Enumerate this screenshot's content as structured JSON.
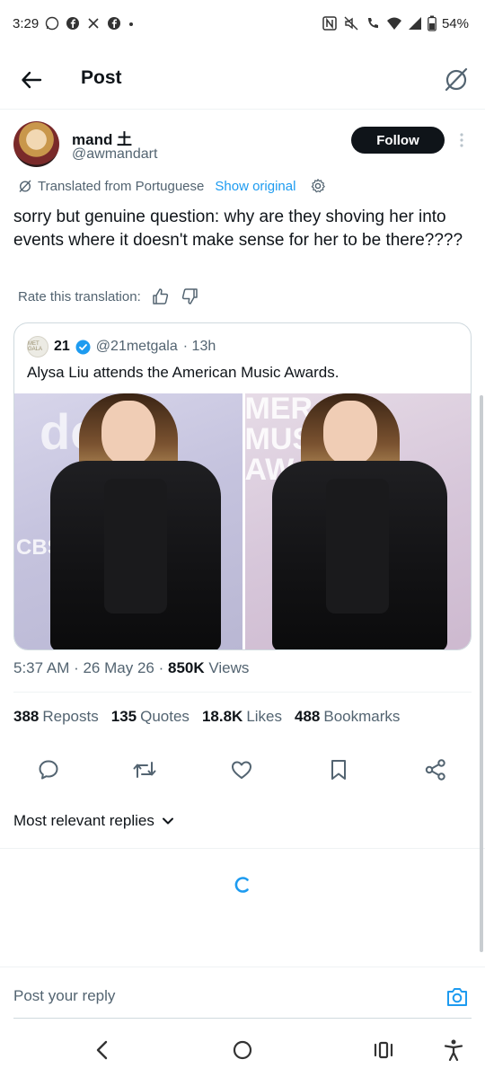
{
  "status_bar": {
    "time": "3:29",
    "battery": "54%"
  },
  "header": {
    "title": "Post"
  },
  "author": {
    "name": "mand 土",
    "handle": "@awmandart",
    "follow_label": "Follow"
  },
  "translation": {
    "translated_from": "Translated from Portuguese",
    "show_original": "Show original"
  },
  "tweet": {
    "text": "sorry but genuine question: why are they shoving her into events where it doesn't make sense for her to be there????",
    "rate_label": "Rate this translation:"
  },
  "quote": {
    "avatar_text": "MET GALA",
    "name": "21",
    "handle": "@21metgala",
    "time": "· 13h",
    "text": "Alysa Liu attends the American Music Awards."
  },
  "meta": {
    "time": "5:37 AM · 26 May 26 ·",
    "views_count": "850K",
    "views_label": "Views"
  },
  "stats": [
    {
      "count": "388",
      "label": "Reposts"
    },
    {
      "count": "135",
      "label": "Quotes"
    },
    {
      "count": "18.8K",
      "label": "Likes"
    },
    {
      "count": "488",
      "label": "Bookmarks"
    }
  ],
  "replies": {
    "sort_label": "Most relevant replies"
  },
  "reply_bar": {
    "placeholder": "Post your reply"
  },
  "colors": {
    "accent": "#1d9bf0",
    "text": "#0f1419",
    "secondary": "#536471"
  },
  "icons": [
    "back-arrow-icon",
    "grok-icon",
    "more-icon",
    "translate-icon",
    "gear-icon",
    "thumbs-up-icon",
    "thumbs-down-icon",
    "verified-icon",
    "reply-icon",
    "repost-icon",
    "like-icon",
    "bookmark-icon",
    "share-icon",
    "chevron-down-icon",
    "camera-icon"
  ]
}
